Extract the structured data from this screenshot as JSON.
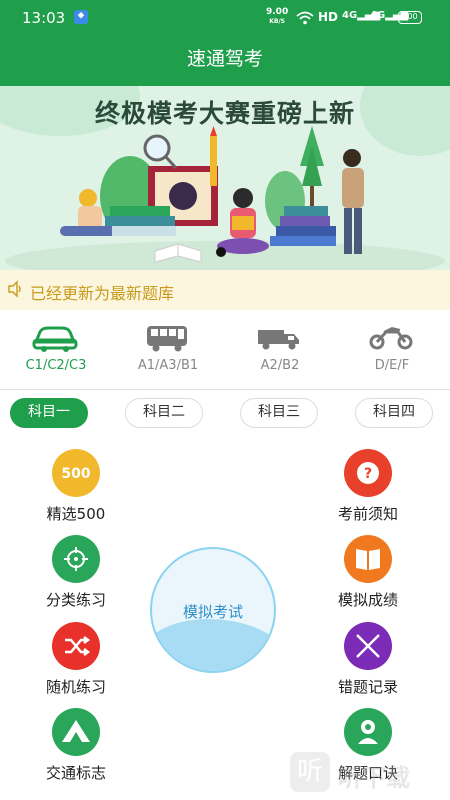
{
  "status_bar": {
    "time": "13:03",
    "net_speed": "9.00",
    "net_unit": "KB/S",
    "hd": "HD",
    "signal1": "4G",
    "signal2": "4G",
    "battery": "100"
  },
  "header": {
    "title": "速通驾考"
  },
  "banner": {
    "title": "终极模考大赛重磅上新"
  },
  "notice": {
    "text": "已经更新为最新题库"
  },
  "licenses": [
    {
      "label": "C1/C2/C3",
      "icon": "car-icon",
      "active": true
    },
    {
      "label": "A1/A3/B1",
      "icon": "bus-icon",
      "active": false
    },
    {
      "label": "A2/B2",
      "icon": "truck-icon",
      "active": false
    },
    {
      "label": "D/E/F",
      "icon": "motorcycle-icon",
      "active": false
    }
  ],
  "subjects": [
    {
      "label": "科目一",
      "active": true
    },
    {
      "label": "科目二",
      "active": false
    },
    {
      "label": "科目三",
      "active": false
    },
    {
      "label": "科目四",
      "active": false
    }
  ],
  "features_left": [
    {
      "label": "精选500",
      "icon": "500-icon",
      "color": "#f0b82a"
    },
    {
      "label": "分类练习",
      "icon": "target-icon",
      "color": "#2aa65a"
    },
    {
      "label": "随机练习",
      "icon": "shuffle-icon",
      "color": "#e8312a"
    },
    {
      "label": "交通标志",
      "icon": "mountain-sign-icon",
      "color": "#2aa65a"
    }
  ],
  "features_right": [
    {
      "label": "考前须知",
      "icon": "question-icon",
      "color": "#e8402a"
    },
    {
      "label": "模拟成绩",
      "icon": "book-icon",
      "color": "#f0781e"
    },
    {
      "label": "错题记录",
      "icon": "cross-icon",
      "color": "#7b2bb5"
    },
    {
      "label": "解题口诀",
      "icon": "person-icon",
      "color": "#2aa65a"
    }
  ],
  "exam_button": {
    "label": "模拟考试"
  },
  "watermark": {
    "icon_text": "听",
    "text": "听下载"
  }
}
